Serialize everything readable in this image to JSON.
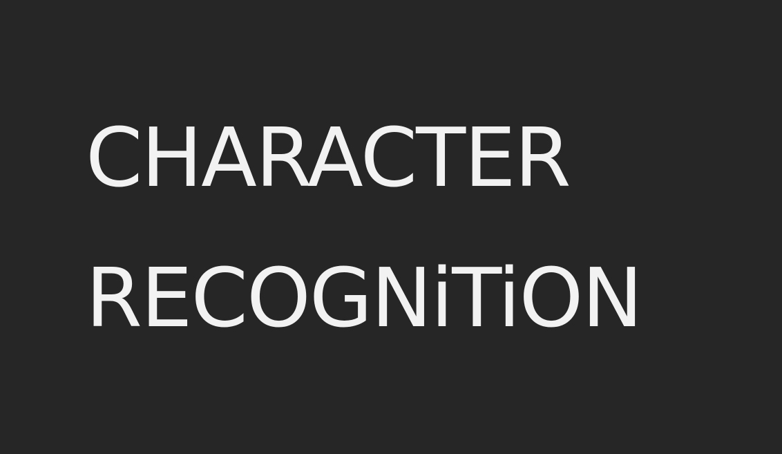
{
  "colors": {
    "background": "#262626",
    "text": "#f2f2f2"
  },
  "title": {
    "line1": "CHARACTER",
    "line2": "RECOGNiTiON"
  }
}
